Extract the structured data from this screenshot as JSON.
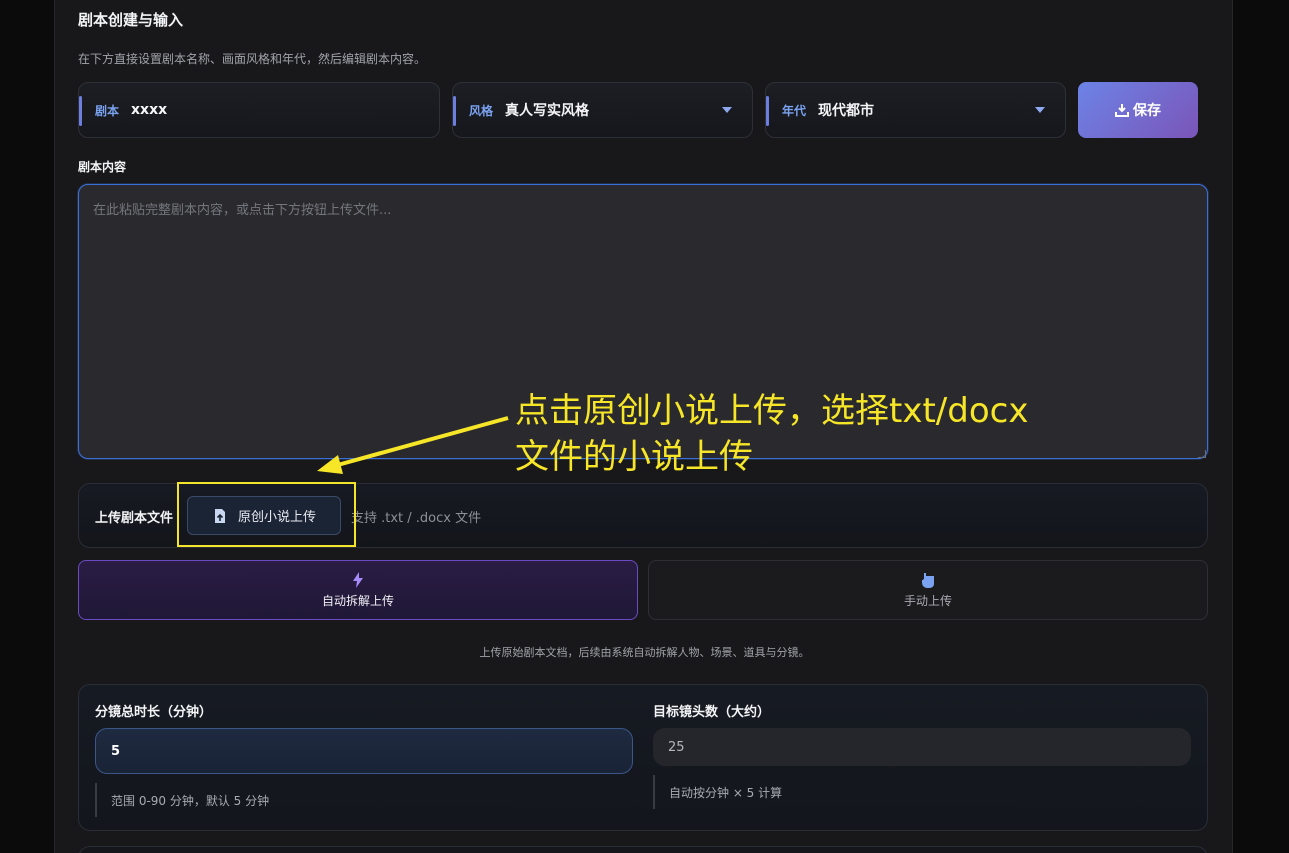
{
  "section": {
    "title": "剧本创建与输入",
    "description": "在下方直接设置剧本名称、画面风格和年代，然后编辑剧本内容。"
  },
  "fields": {
    "script": {
      "label": "剧本",
      "value": "xxxx"
    },
    "style": {
      "label": "风格",
      "value": "真人写实风格"
    },
    "era": {
      "label": "年代",
      "value": "现代都市"
    }
  },
  "save_label": "保存",
  "content": {
    "label": "剧本内容",
    "placeholder": "在此粘贴完整剧本内容，或点击下方按钮上传文件..."
  },
  "upload": {
    "label": "上传剧本文件",
    "button_label": "原创小说上传",
    "hint": "支持 .txt / .docx 文件"
  },
  "modes": {
    "auto_label": "自动拆解上传",
    "manual_label": "手动上传",
    "description": "上传原始剧本文档，后续由系统自动拆解人物、场景、道具与分镜。"
  },
  "duration": {
    "label": "分镜总时长（分钟）",
    "value": "5",
    "note": "范围 0-90 分钟，默认 5 分钟"
  },
  "shots": {
    "label": "目标镜头数（大约）",
    "value": "25",
    "note": "自动按分钟 × 5 计算"
  },
  "annotation": {
    "line1": "点击原创小说上传，选择txt/docx",
    "line2": "文件的小说上传",
    "color": "#f7e628"
  },
  "colors": {
    "accent": "#3a6fd8",
    "save_gradient_start": "#6c83e6",
    "save_gradient_end": "#7b55b8",
    "auto_mode_border": "#6a4cc0"
  }
}
